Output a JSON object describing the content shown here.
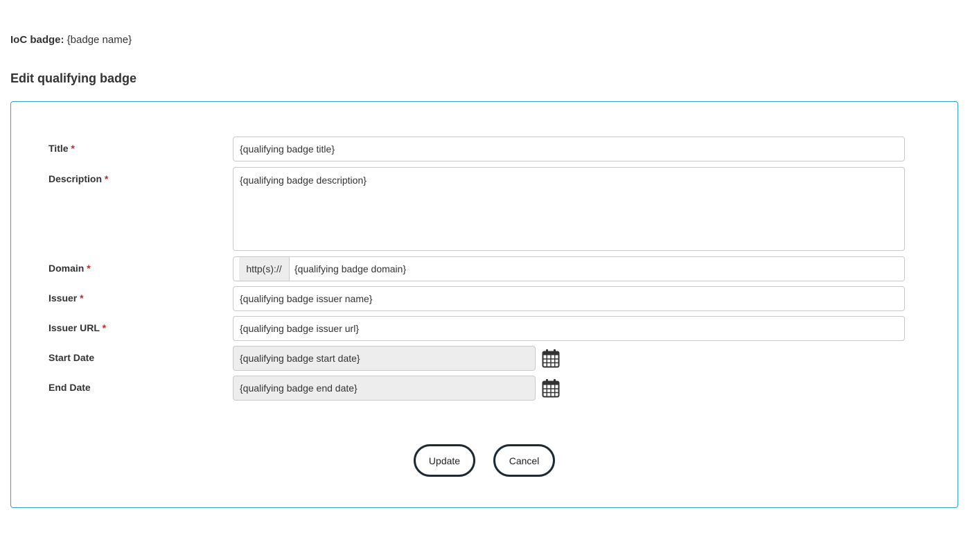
{
  "header": {
    "ioc_label": "IoC badge:",
    "ioc_value": "{badge name}",
    "section_title": "Edit qualifying badge"
  },
  "form": {
    "required_marker": "*",
    "title": {
      "label": "Title",
      "value": "{qualifying badge title}"
    },
    "description": {
      "label": "Description",
      "value": "{qualifying badge description}"
    },
    "domain": {
      "label": "Domain",
      "prefix": "http(s)://",
      "value": "{qualifying badge domain}"
    },
    "issuer": {
      "label": "Issuer",
      "value": "{qualifying badge issuer name}"
    },
    "issuer_url": {
      "label": "Issuer URL",
      "value": "{qualifying badge issuer url}"
    },
    "start_date": {
      "label": "Start Date",
      "value": "{qualifying badge start date}",
      "icon": "calendar-icon"
    },
    "end_date": {
      "label": "End Date",
      "value": "{qualifying badge end date}",
      "icon": "calendar-icon"
    }
  },
  "actions": {
    "update_label": "Update",
    "cancel_label": "Cancel"
  },
  "colors": {
    "card_border": "#2fa4c7",
    "required": "#c0282d",
    "button_border": "#1b2a33",
    "readonly_bg": "#ededed"
  }
}
